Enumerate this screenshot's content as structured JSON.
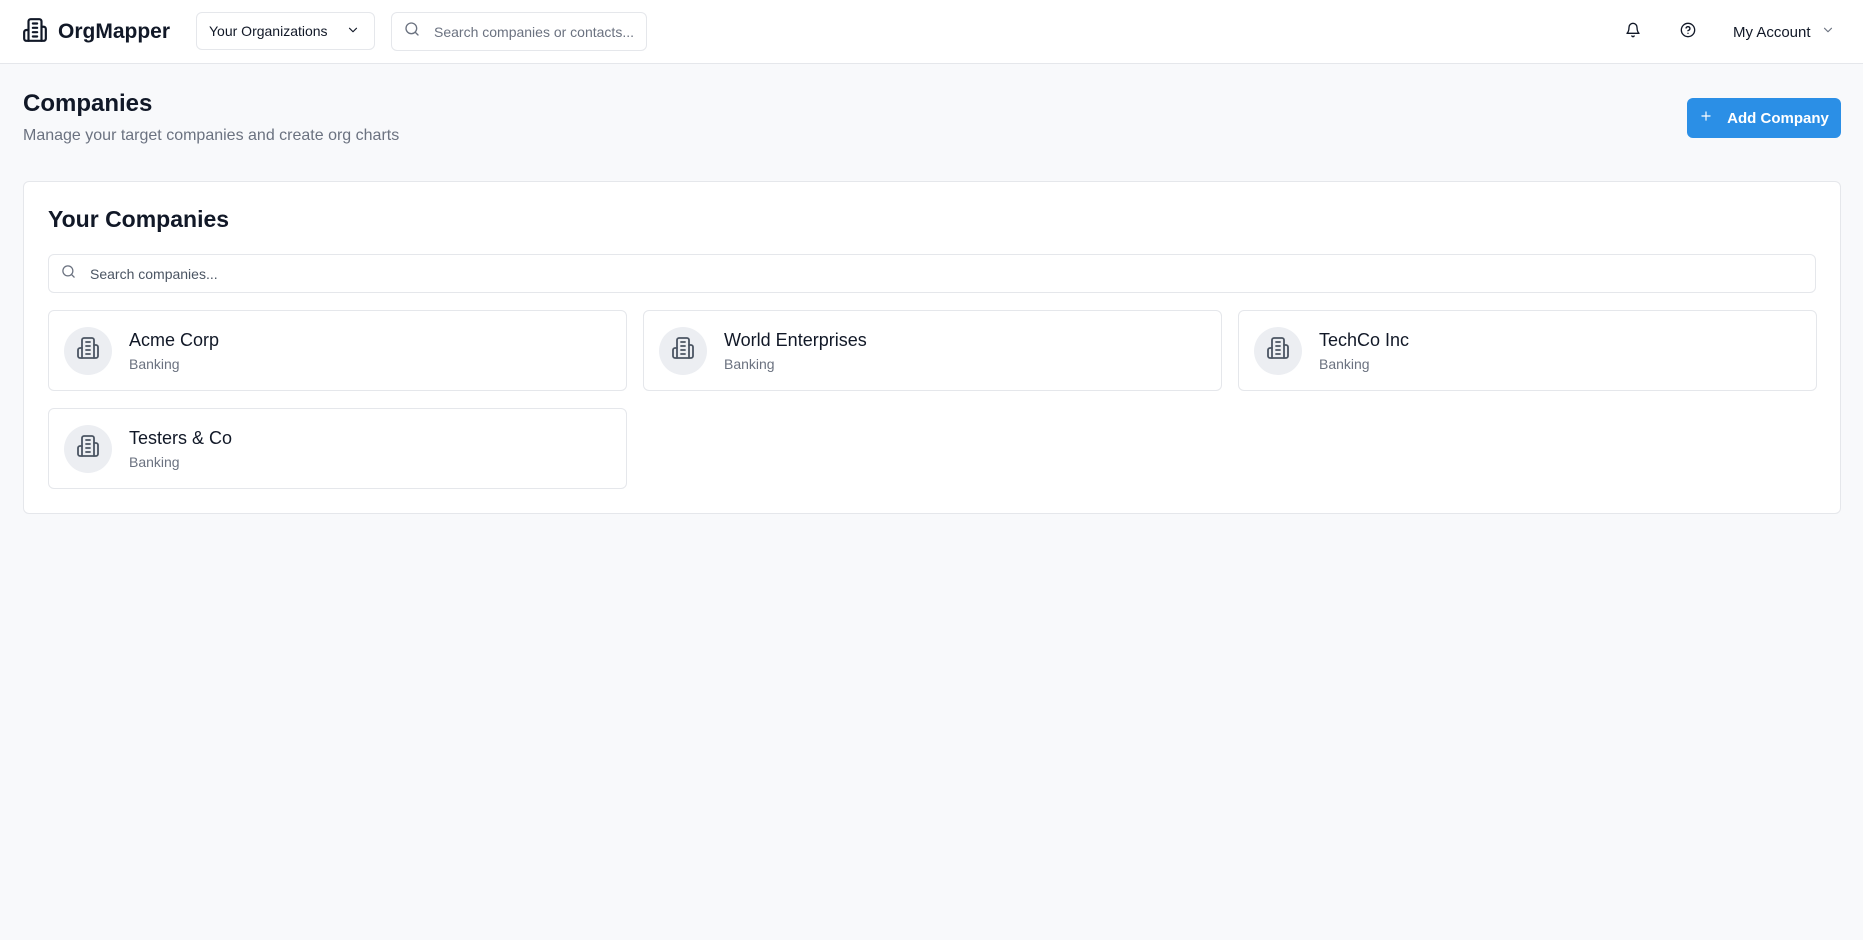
{
  "header": {
    "brand": "OrgMapper",
    "org_selector": "Your Organizations",
    "search_placeholder": "Search companies or contacts...",
    "account_label": "My Account"
  },
  "page": {
    "title": "Companies",
    "subtitle": "Manage your target companies and create org charts",
    "add_button": "Add Company"
  },
  "panel": {
    "title": "Your Companies",
    "search_placeholder": "Search companies..."
  },
  "companies": [
    {
      "name": "Acme Corp",
      "industry": "Banking"
    },
    {
      "name": "World Enterprises",
      "industry": "Banking"
    },
    {
      "name": "TechCo Inc",
      "industry": "Banking"
    },
    {
      "name": "Testers & Co",
      "industry": "Banking"
    }
  ],
  "icons": {
    "brand": "building-icon",
    "org_selector": "chevron-down-icon",
    "search": "search-icon",
    "notifications": "bell-icon",
    "help": "help-circle-icon",
    "account": "chevron-down-icon",
    "add": "plus-icon",
    "company": "building-icon"
  },
  "colors": {
    "accent": "#2b8fe6",
    "background": "#f8f9fb",
    "avatar_bg": "#eceef2"
  }
}
